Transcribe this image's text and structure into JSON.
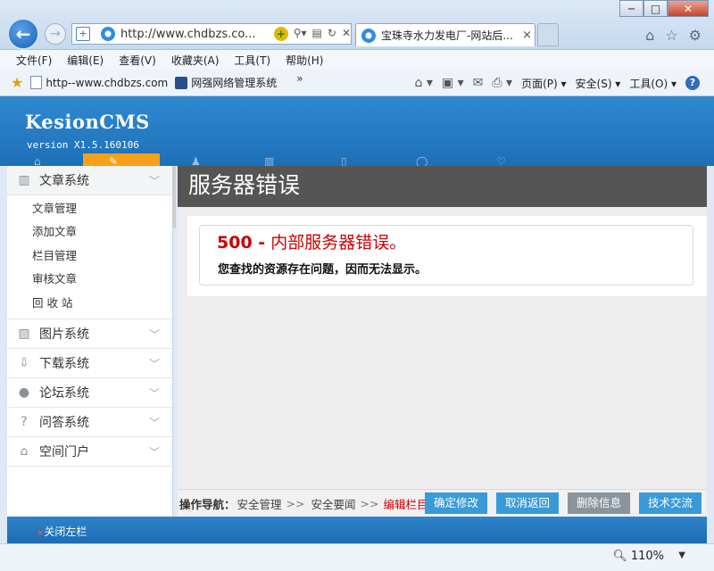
{
  "browser": {
    "url": "http://www.chdbzs.co...",
    "tab_title": "宝珠寺水力发电厂-网站后...",
    "tab_close": "×",
    "window_min": "─",
    "window_max": "□",
    "window_close": "✕",
    "menu": [
      "文件(F)",
      "编辑(E)",
      "查看(V)",
      "收藏夹(A)",
      "工具(T)",
      "帮助(H)"
    ],
    "favorites": [
      "http--www.chdbzs.com",
      "网强网络管理系统"
    ],
    "toolbar": {
      "page": "页面(P) ▾",
      "safety": "安全(S) ▾",
      "tools": "工具(O) ▾"
    },
    "zoom": "110%"
  },
  "cms": {
    "logo": "KesionCMS",
    "version": "version X1.5.160106"
  },
  "sidebar": {
    "groups": [
      {
        "label": "文章系统",
        "icon": "book-icon",
        "open": true,
        "items": [
          "文章管理",
          "添加文章",
          "栏目管理",
          "审核文章",
          "回 收 站"
        ]
      },
      {
        "label": "图片系统",
        "icon": "image-icon"
      },
      {
        "label": "下载系统",
        "icon": "download-icon"
      },
      {
        "label": "论坛系统",
        "icon": "chat-icon"
      },
      {
        "label": "问答系统",
        "icon": "question-icon"
      },
      {
        "label": "空间门户",
        "icon": "home-icon"
      }
    ]
  },
  "error": {
    "title": "服务器错误",
    "code": "500 -",
    "code_text": " 内部服务器错误。",
    "message": "您查找的资源存在问题，因而无法显示。"
  },
  "opbar": {
    "label": "操作导航：",
    "crumbs": [
      "安全管理",
      "安全要闻"
    ],
    "separator": ">>",
    "current": "编辑栏目",
    "buttons": {
      "confirm": "确定修改",
      "cancel": "取消返回",
      "delete": "删除信息",
      "tech": "技术交流"
    }
  },
  "footer": {
    "close_left": "关闭左栏"
  }
}
